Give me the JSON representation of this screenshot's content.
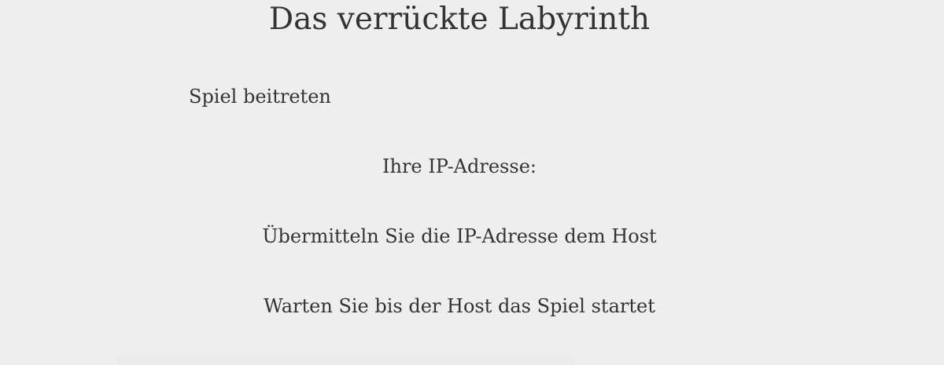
{
  "header": {
    "title": "Das verrückte Labyrinth"
  },
  "screen": {
    "heading": "Spiel beitreten",
    "ip_label": "Ihre IP-Adresse:",
    "instruction_send": "Übermitteln Sie die IP-Adresse dem Host",
    "instruction_wait": "Warten Sie bis der Host das Spiel startet"
  }
}
